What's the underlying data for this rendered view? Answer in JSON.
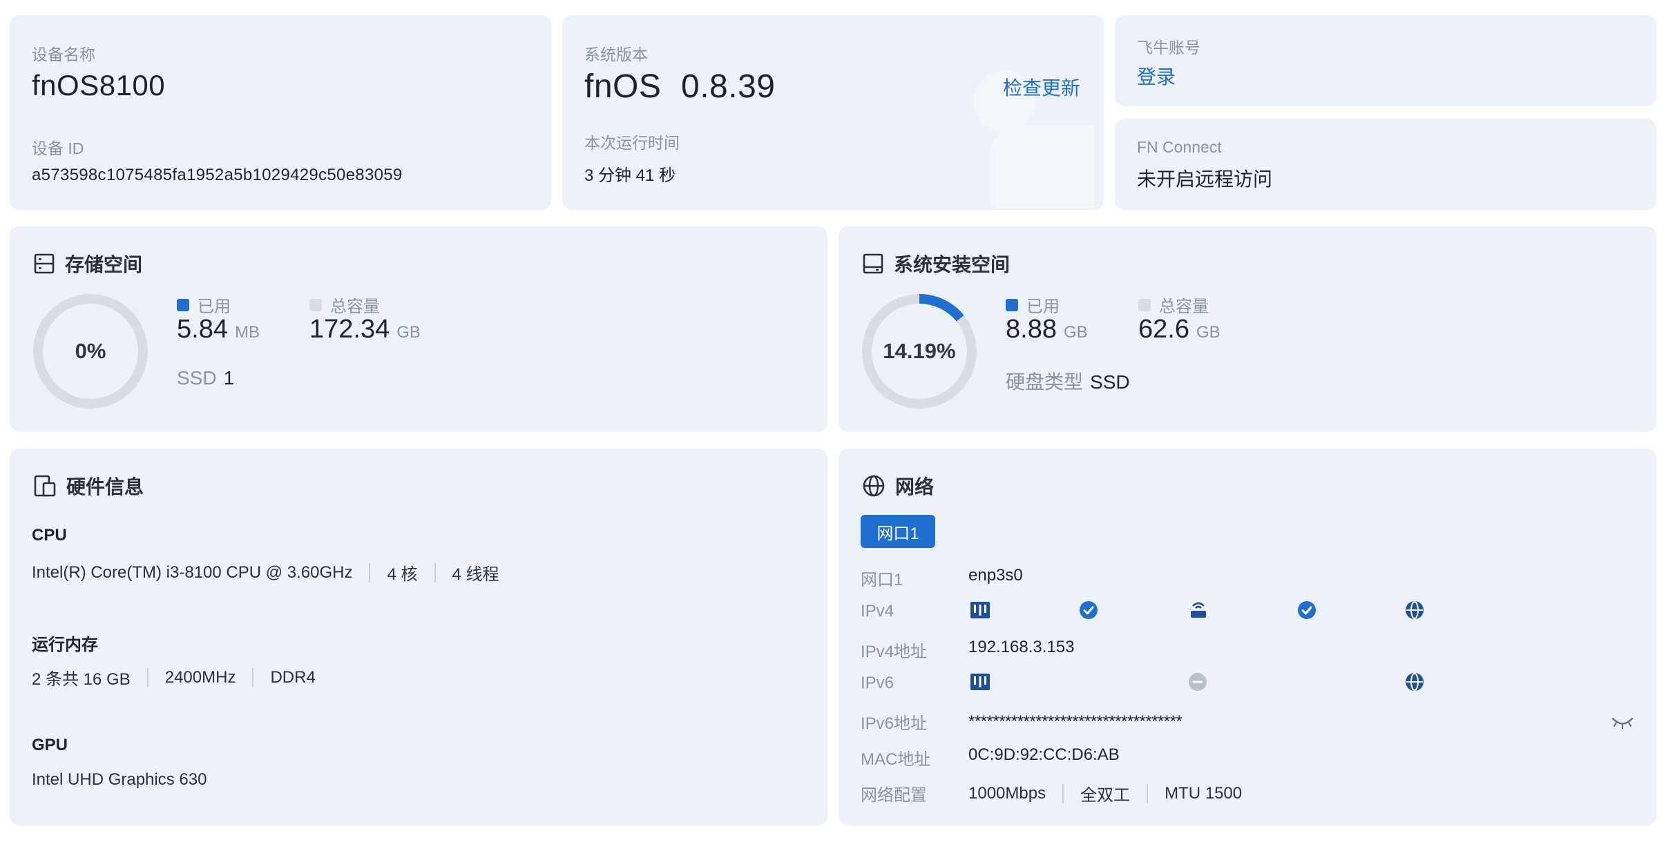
{
  "device": {
    "name_label": "设备名称",
    "name": "fnOS8100",
    "id_label": "设备 ID",
    "id": "a573598c1075485fa1952a5b1029429c50e83059"
  },
  "system": {
    "version_label": "系统版本",
    "os_name": "fnOS",
    "version": "0.8.39",
    "check_update": "检查更新",
    "uptime_label": "本次运行时间",
    "uptime": "3 分钟 41 秒"
  },
  "account": {
    "label": "飞牛账号",
    "login": "登录"
  },
  "fn_connect": {
    "label": "FN Connect",
    "status": "未开启远程访问"
  },
  "storage": {
    "title": "存储空间",
    "percent": "0%",
    "used_fraction": 0,
    "used_label": "已用",
    "used_value": "5.84",
    "used_unit": "MB",
    "total_label": "总容量",
    "total_value": "172.34",
    "total_unit": "GB",
    "ssd_label": "SSD",
    "ssd_count": "1"
  },
  "sys_storage": {
    "title": "系统安装空间",
    "percent": "14.19%",
    "used_fraction": 0.1419,
    "used_label": "已用",
    "used_value": "8.88",
    "used_unit": "GB",
    "total_label": "总容量",
    "total_value": "62.6",
    "total_unit": "GB",
    "disk_type_label": "硬盘类型",
    "disk_type": "SSD"
  },
  "hardware": {
    "title": "硬件信息",
    "cpu_label": "CPU",
    "cpu_model": "Intel(R) Core(TM) i3-8100 CPU @ 3.60GHz",
    "cpu_cores": "4 核",
    "cpu_threads": "4 线程",
    "mem_label": "运行内存",
    "mem_size": "2 条共 16 GB",
    "mem_freq": "2400MHz",
    "mem_type": "DDR4",
    "gpu_label": "GPU",
    "gpu_model": "Intel UHD Graphics 630"
  },
  "network": {
    "title": "网络",
    "tab": "网口1",
    "rows": {
      "port_label": "网口1",
      "port_value": "enp3s0",
      "ipv4_label": "IPv4",
      "ipv4_addr_label": "IPv4地址",
      "ipv4_addr": "192.168.3.153",
      "ipv6_label": "IPv6",
      "ipv6_addr_label": "IPv6地址",
      "ipv6_addr": "***********************************",
      "mac_label": "MAC地址",
      "mac": "0C:9D:92:CC:D6:AB",
      "config_label": "网络配置",
      "speed": "1000Mbps",
      "duplex": "全双工",
      "mtu": "MTU 1500"
    }
  },
  "colors": {
    "accent": "#1f6fd1",
    "card_bg": "#edf2f8",
    "ring_track": "#d9dde3",
    "muted": "#8a939e"
  }
}
